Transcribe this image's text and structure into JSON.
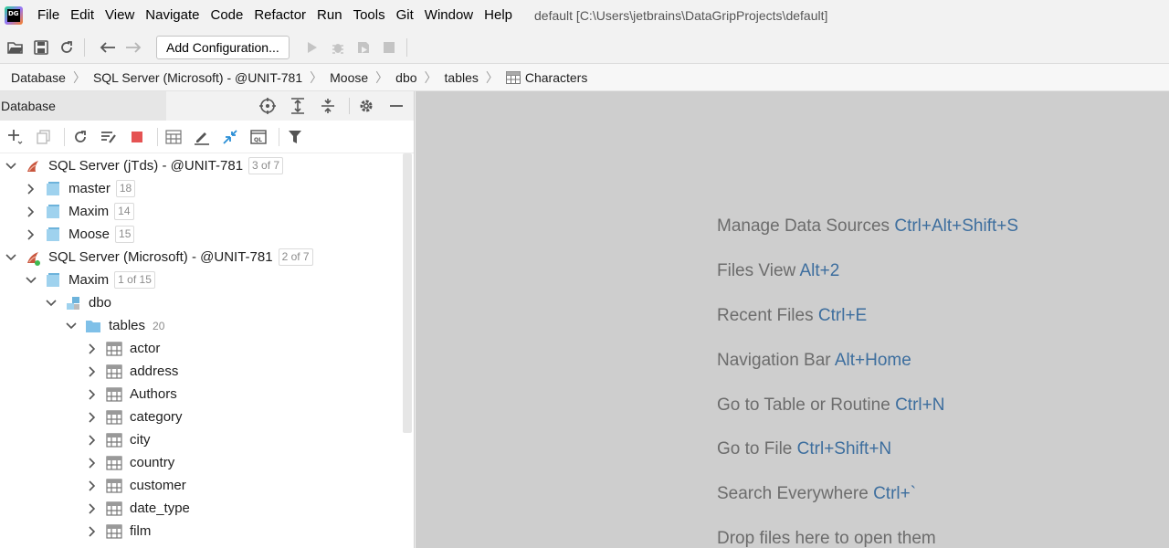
{
  "app": {
    "logo_text": "DG",
    "window_title": "default [C:\\Users\\jetbrains\\DataGripProjects\\default]"
  },
  "menu": [
    {
      "label": "File"
    },
    {
      "label": "Edit"
    },
    {
      "label": "View"
    },
    {
      "label": "Navigate"
    },
    {
      "label": "Code"
    },
    {
      "label": "Refactor"
    },
    {
      "label": "Run"
    },
    {
      "label": "Tools"
    },
    {
      "label": "Git"
    },
    {
      "label": "Window"
    },
    {
      "label": "Help"
    }
  ],
  "toolbar": {
    "config_label": "Add Configuration..."
  },
  "breadcrumb": [
    {
      "label": "Database"
    },
    {
      "label": "SQL Server (Microsoft) - @UNIT-781"
    },
    {
      "label": "Moose"
    },
    {
      "label": "dbo"
    },
    {
      "label": "tables"
    },
    {
      "label": "Characters"
    }
  ],
  "panel": {
    "title": "Database"
  },
  "tree": [
    {
      "label": "SQL Server (jTds) - @UNIT-781",
      "count": "3 of 7"
    },
    {
      "label": "master",
      "count": "18"
    },
    {
      "label": "Maxim",
      "count": "14"
    },
    {
      "label": "Moose",
      "count": "15"
    },
    {
      "label": "SQL Server (Microsoft) - @UNIT-781",
      "count": "2 of 7"
    },
    {
      "label": "Maxim",
      "count": "1 of 15"
    },
    {
      "label": "dbo",
      "count": ""
    },
    {
      "label": "tables",
      "count": "20"
    },
    {
      "label": "actor"
    },
    {
      "label": "address"
    },
    {
      "label": "Authors"
    },
    {
      "label": "category"
    },
    {
      "label": "city"
    },
    {
      "label": "country"
    },
    {
      "label": "customer"
    },
    {
      "label": "date_type"
    },
    {
      "label": "film"
    }
  ],
  "hints": [
    {
      "text": "Manage Data Sources",
      "key": "Ctrl+Alt+Shift+S"
    },
    {
      "text": "Files View",
      "key": "Alt+2"
    },
    {
      "text": "Recent Files",
      "key": "Ctrl+E"
    },
    {
      "text": "Navigation Bar",
      "key": "Alt+Home"
    },
    {
      "text": "Go to Table or Routine",
      "key": "Ctrl+N"
    },
    {
      "text": "Go to File",
      "key": "Ctrl+Shift+N"
    },
    {
      "text": "Search Everywhere",
      "key": "Ctrl+`"
    },
    {
      "text": "Drop files here to open them",
      "key": ""
    }
  ],
  "colors": {
    "accent_key": "#3d6e9e",
    "folder_blue": "#7fc0e8",
    "stop_red": "#e55353"
  }
}
